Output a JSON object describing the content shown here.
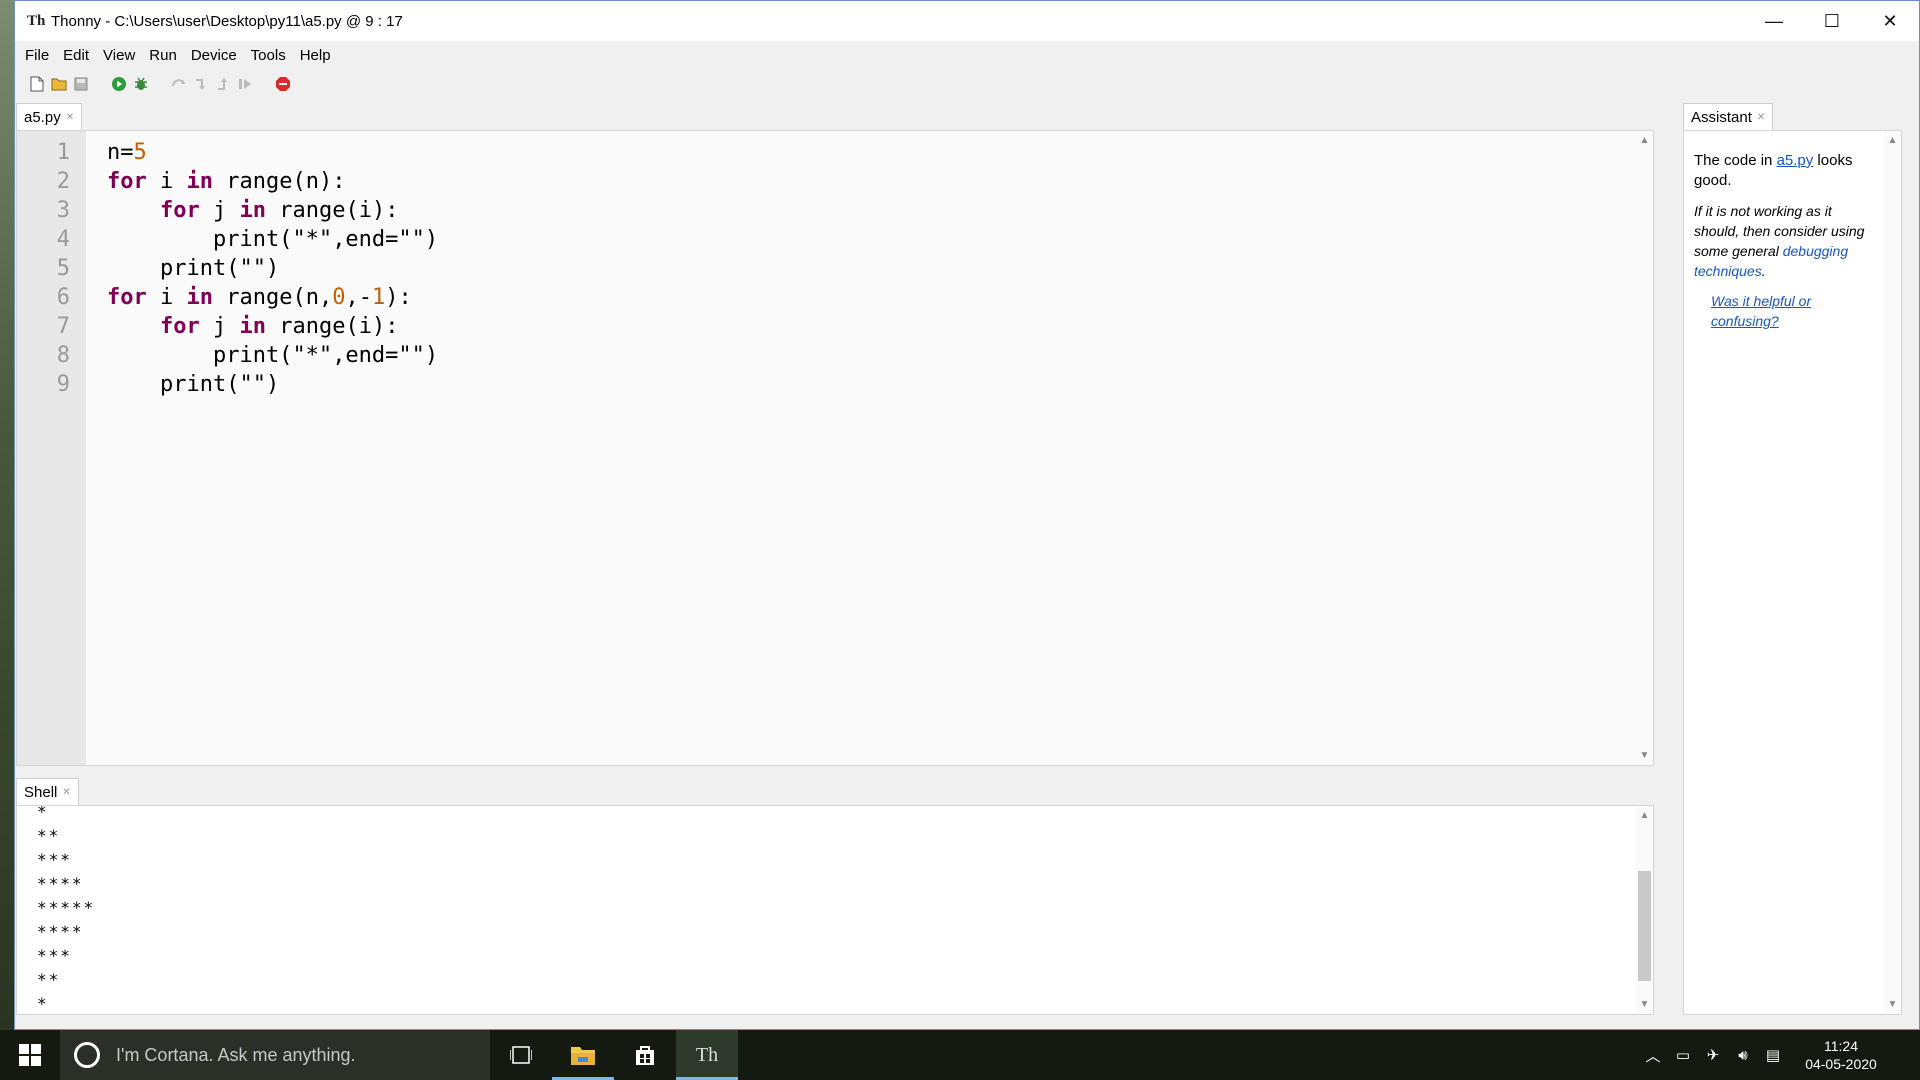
{
  "window": {
    "title": "Thonny  -  C:\\Users\\user\\Desktop\\py11\\a5.py  @  9 : 17",
    "minimize": "—",
    "maximize": "☐",
    "close": "✕"
  },
  "menu": [
    "File",
    "Edit",
    "View",
    "Run",
    "Device",
    "Tools",
    "Help"
  ],
  "toolbar_icons": [
    "new-file-icon",
    "open-file-icon",
    "save-icon",
    "run-icon",
    "debug-icon",
    "step-over-icon",
    "step-into-icon",
    "step-out-icon",
    "resume-icon",
    "stop-icon"
  ],
  "editor": {
    "tab_label": "a5.py",
    "line_numbers": [
      "1",
      "2",
      "3",
      "4",
      "5",
      "6",
      "7",
      "8",
      "9"
    ]
  },
  "shell": {
    "tab_label": "Shell",
    "output": [
      "*",
      "**",
      "***",
      "****",
      "*****",
      "****",
      "***",
      "**",
      "*"
    ]
  },
  "assistant": {
    "tab_label": "Assistant",
    "msg_prefix": "The code in ",
    "msg_file": "a5.py",
    "msg_suffix": " looks good.",
    "hint_prefix": "If it is not working as it should, then consider using some general ",
    "hint_link": "debugging techniques",
    "hint_suffix": ".",
    "feedback": "Was it helpful or confusing?"
  },
  "taskbar": {
    "search_placeholder": "I'm Cortana. Ask me anything.",
    "time": "11:24",
    "date": "04-05-2020"
  },
  "colors": {
    "keyword": "#7f0055",
    "number": "#c06000",
    "link": "#1b55c4"
  }
}
